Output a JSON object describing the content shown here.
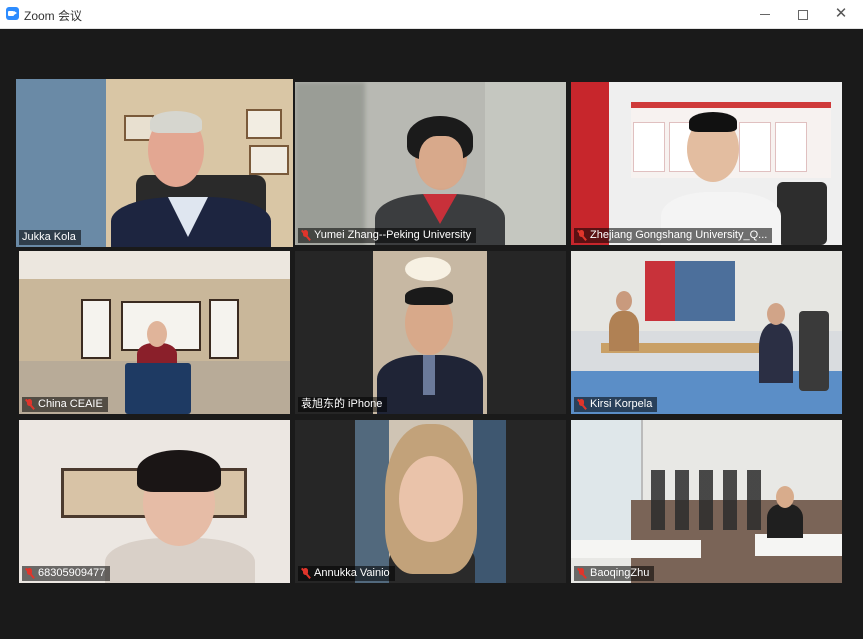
{
  "window": {
    "title": "Zoom 会议",
    "minimize": "—",
    "maximize": "☐",
    "close": "✕"
  },
  "participants": [
    {
      "name": "Jukka Kola",
      "muted": false,
      "active": true
    },
    {
      "name": "Yumei Zhang--Peking University",
      "muted": true,
      "active": false
    },
    {
      "name": "Zhejiang Gongshang University_Q...",
      "muted": true,
      "active": false
    },
    {
      "name": "China CEAIE",
      "muted": true,
      "active": false
    },
    {
      "name": "袁旭东的 iPhone",
      "muted": false,
      "active": false
    },
    {
      "name": "Kirsi Korpela",
      "muted": true,
      "active": false
    },
    {
      "name": "68305909477",
      "muted": true,
      "active": false
    },
    {
      "name": "Annukka Vainio",
      "muted": true,
      "active": false
    },
    {
      "name": "BaoqingZhu",
      "muted": true,
      "active": false
    }
  ],
  "colors": {
    "active_speaker_border": "#c5e86c",
    "mute_icon": "#e0352b",
    "background": "#1a1a1a"
  }
}
